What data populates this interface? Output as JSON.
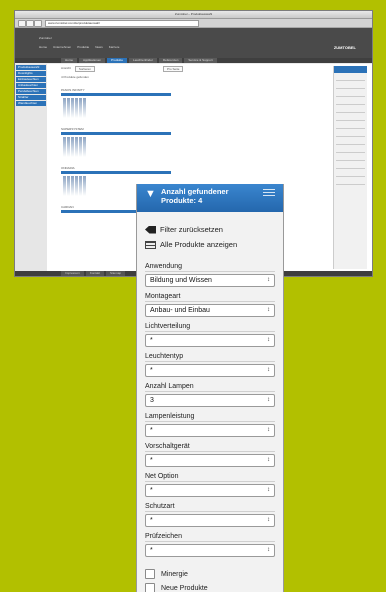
{
  "browser": {
    "window_title": "Zumtobel – Produktauswahl",
    "url": "www.zumtobel.com/de/produktauswahl",
    "header_text": "Zumtobel",
    "header_nav": [
      "Home",
      "Unternehmen",
      "Produkte",
      "News",
      "Karriere"
    ],
    "brand": "ZUMTOBEL",
    "main_nav": [
      "Home",
      "Applikationen",
      "Produkte",
      "Leuchtenfinder",
      "Referenzen",
      "Service & Support"
    ],
    "left_nav": [
      "Produktauswahl",
      "Downlights",
      "Einbauleuchten",
      "Anbauleuchten",
      "Pendelleuchten",
      "Strahler",
      "Wandleuchten"
    ],
    "controls": [
      "Ansicht",
      "Sortieren",
      "Pro Seite"
    ],
    "list_hint": "4 Produkte gefunden",
    "products": [
      "PANOS INFINITY",
      "SUPERSYSTEM",
      "ONDARIA",
      "CARDAN"
    ],
    "footer": [
      "Impressum",
      "Kontakt",
      "Sitemap"
    ]
  },
  "panel": {
    "title": "Anzahl gefundener Produkte: 4",
    "reset_label": "Filter zurücksetzen",
    "show_all_label": "Alle Produkte anzeigen",
    "filters": [
      {
        "label": "Anwendung",
        "value": "Bildung und Wissen"
      },
      {
        "label": "Montageart",
        "value": "Anbau- und Einbau"
      },
      {
        "label": "Lichtverteilung",
        "value": "*"
      },
      {
        "label": "Leuchtentyp",
        "value": "*"
      },
      {
        "label": "Anzahl Lampen",
        "value": "3"
      },
      {
        "label": "Lampenleistung",
        "value": "*"
      },
      {
        "label": "Vorschaltgerät",
        "value": "*"
      },
      {
        "label": "Net Option",
        "value": "*"
      },
      {
        "label": "Schutzart",
        "value": "*"
      },
      {
        "label": "Prüfzeichen",
        "value": "*"
      }
    ],
    "checkboxes": [
      {
        "label": "Minergie"
      },
      {
        "label": "Neue Produkte"
      }
    ]
  },
  "colors": {
    "accent": "#2b72b8",
    "background": "#b2c000"
  },
  "icons": {
    "plus": "+",
    "filter": "filter-funnel-icon"
  }
}
